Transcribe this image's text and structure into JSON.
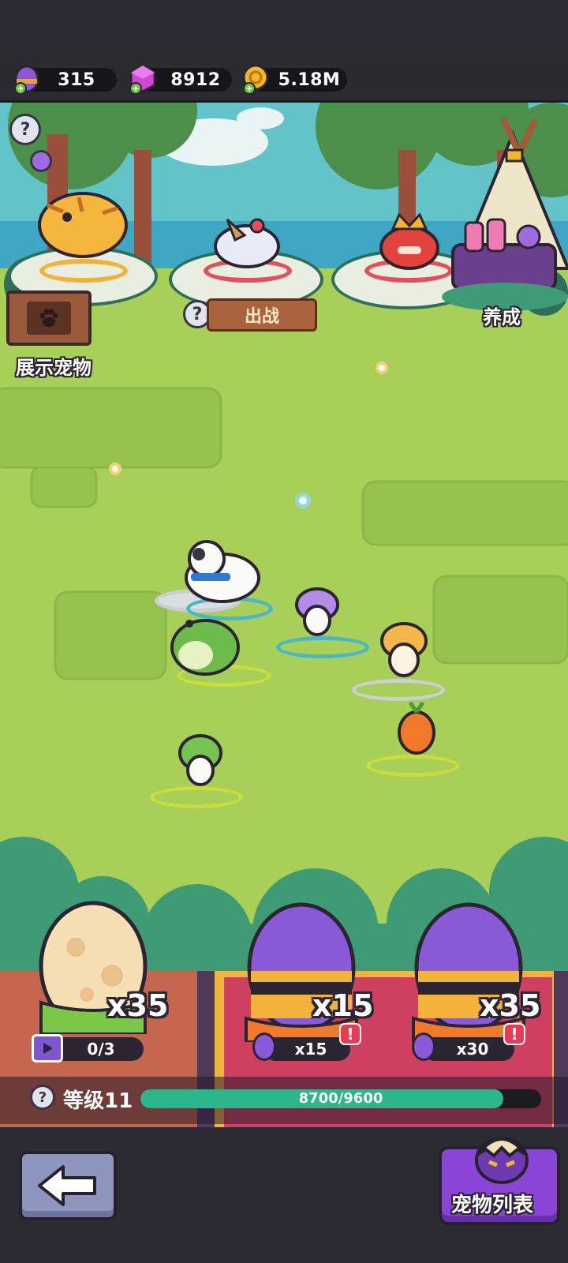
{
  "resources": {
    "eggs": "315",
    "gems": "8912",
    "coins": "5.18M"
  },
  "scene": {
    "deploy_label": "出战",
    "display_label": "展示宠物",
    "nurture_label": "养成"
  },
  "eggs": [
    {
      "count": "x35",
      "sub": "0/3",
      "type": "normal"
    },
    {
      "count": "x15",
      "sub": "x15",
      "type": "rare"
    },
    {
      "count": "x35",
      "sub": "x30",
      "type": "rare"
    }
  ],
  "level": {
    "label": "等级11",
    "xp_text": "8700/9600",
    "xp_fraction": 0.906
  },
  "bottom": {
    "pet_list_label": "宠物列表"
  },
  "colors": {
    "accent_purple": "#8b45d6",
    "xp_green": "#2bb68b",
    "alert_red": "#e83c52",
    "grass": "#a8cf57"
  }
}
